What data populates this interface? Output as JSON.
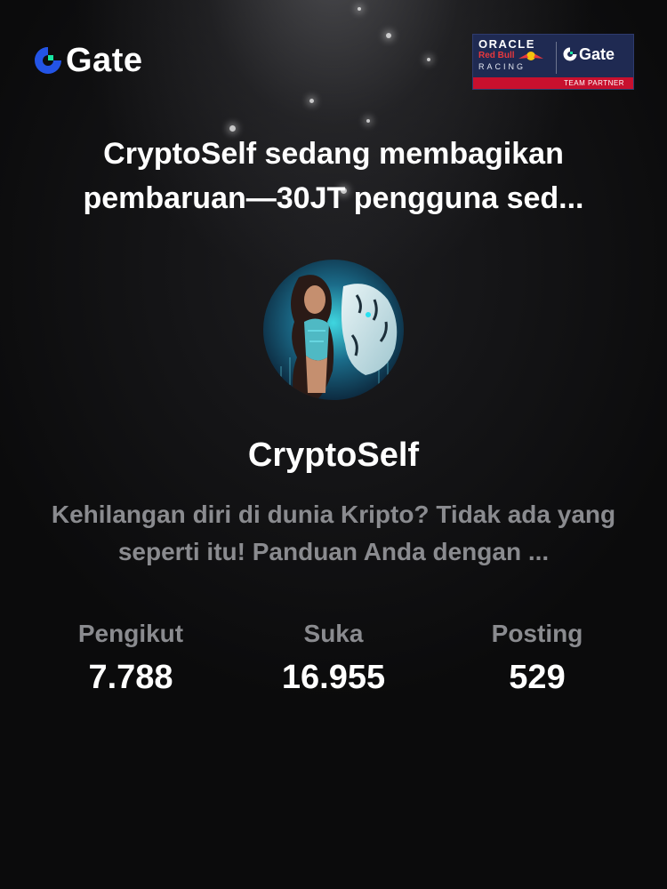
{
  "brand": {
    "logo_text": "Gate",
    "accent_color": "#17e6a1",
    "logo_blue": "#2354e6"
  },
  "partner_badge": {
    "oracle": "ORACLE",
    "redbull": "Red Bull",
    "racing": "RACING",
    "gate_text": "Gate",
    "team_partner": "TEAM PARTNER",
    "background_color": "#1f2a52",
    "band_color": "#c8102e"
  },
  "headline": "CryptoSelf sedang membagikan pembaruan—30JT pengguna sed...",
  "profile": {
    "avatar_icon": "avatar-image",
    "name": "CryptoSelf",
    "bio": "Kehilangan diri di dunia Kripto? Tidak ada yang seperti itu! Panduan Anda dengan ..."
  },
  "stats": [
    {
      "label": "Pengikut",
      "value": "7.788"
    },
    {
      "label": "Suka",
      "value": "16.955"
    },
    {
      "label": "Posting",
      "value": "529"
    }
  ]
}
